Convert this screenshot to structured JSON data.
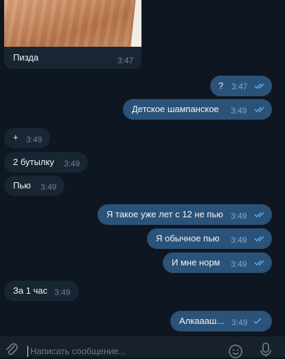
{
  "messages": [
    {
      "side": "in",
      "kind": "photo",
      "text": "Пизда",
      "time": "3:47"
    },
    {
      "side": "out",
      "text": "?",
      "time": "3:47",
      "ticks": "double"
    },
    {
      "side": "out",
      "text": "Детское шампанское",
      "time": "3:49",
      "ticks": "double"
    },
    {
      "side": "in",
      "text": "+",
      "time": "3:49"
    },
    {
      "side": "in",
      "text": "2 бутылку",
      "time": "3:49"
    },
    {
      "side": "in",
      "text": "Пью",
      "time": "3:49"
    },
    {
      "side": "out",
      "text": "Я такое уже лет с 12 не пью",
      "time": "3:49",
      "ticks": "double"
    },
    {
      "side": "out",
      "text": "Я обычное пью",
      "time": "3:49",
      "ticks": "double"
    },
    {
      "side": "out",
      "text": "И мне норм",
      "time": "3:49",
      "ticks": "double"
    },
    {
      "side": "in",
      "text": "За 1 час",
      "time": "3:49"
    },
    {
      "side": "out",
      "text": "Алкаааш...",
      "time": "3:49",
      "ticks": "single"
    }
  ],
  "composer": {
    "placeholder": "Написать сообщение...",
    "icons": [
      "paperclip-icon",
      "emoji-icon",
      "microphone-icon"
    ]
  },
  "colors": {
    "background": "#0e1621",
    "incoming_bubble": "#182533",
    "outgoing_bubble": "#2b5278",
    "check_color": "#6ab3f3"
  }
}
